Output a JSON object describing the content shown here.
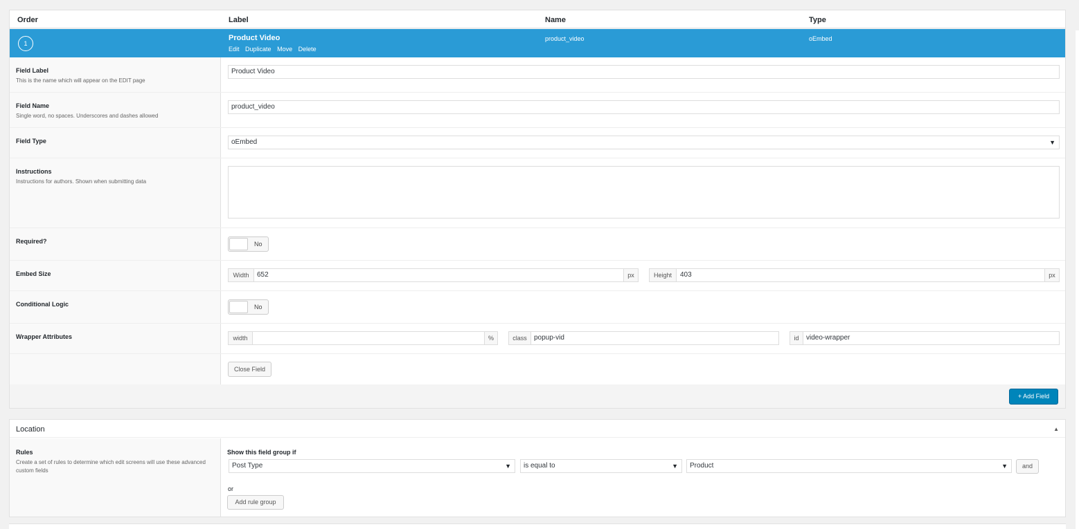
{
  "header": {
    "order": "Order",
    "label": "Label",
    "name": "Name",
    "type": "Type"
  },
  "field": {
    "order": "1",
    "label": "Product Video",
    "name": "product_video",
    "type": "oEmbed",
    "actions": {
      "edit": "Edit",
      "duplicate": "Duplicate",
      "move": "Move",
      "delete": "Delete"
    }
  },
  "settings": {
    "field_label": {
      "label": "Field Label",
      "desc": "This is the name which will appear on the EDIT page",
      "value": "Product Video"
    },
    "field_name": {
      "label": "Field Name",
      "desc": "Single word, no spaces. Underscores and dashes allowed",
      "value": "product_video"
    },
    "field_type": {
      "label": "Field Type",
      "value": "oEmbed"
    },
    "instructions": {
      "label": "Instructions",
      "desc": "Instructions for authors. Shown when submitting data",
      "value": ""
    },
    "required": {
      "label": "Required?",
      "toggle": "No"
    },
    "embed_size": {
      "label": "Embed Size",
      "width_label": "Width",
      "width_value": "652",
      "width_unit": "px",
      "height_label": "Height",
      "height_value": "403",
      "height_unit": "px"
    },
    "conditional_logic": {
      "label": "Conditional Logic",
      "toggle": "No"
    },
    "wrapper": {
      "label": "Wrapper Attributes",
      "width_label": "width",
      "width_value": "",
      "width_unit": "%",
      "class_label": "class",
      "class_value": "popup-vid",
      "id_label": "id",
      "id_value": "video-wrapper"
    },
    "close_button": "Close Field"
  },
  "add_field_button": "+ Add Field",
  "location": {
    "title": "Location",
    "rules_label": "Rules",
    "rules_desc": "Create a set of rules to determine which edit screens will use these advanced custom fields",
    "show_if": "Show this field group if",
    "param": "Post Type",
    "operator": "is equal to",
    "value": "Product",
    "and_button": "and",
    "or_text": "or",
    "add_rule_group": "Add rule group"
  },
  "colors": {
    "accent": "#2a9bd6",
    "primary_button": "#0085ba"
  }
}
